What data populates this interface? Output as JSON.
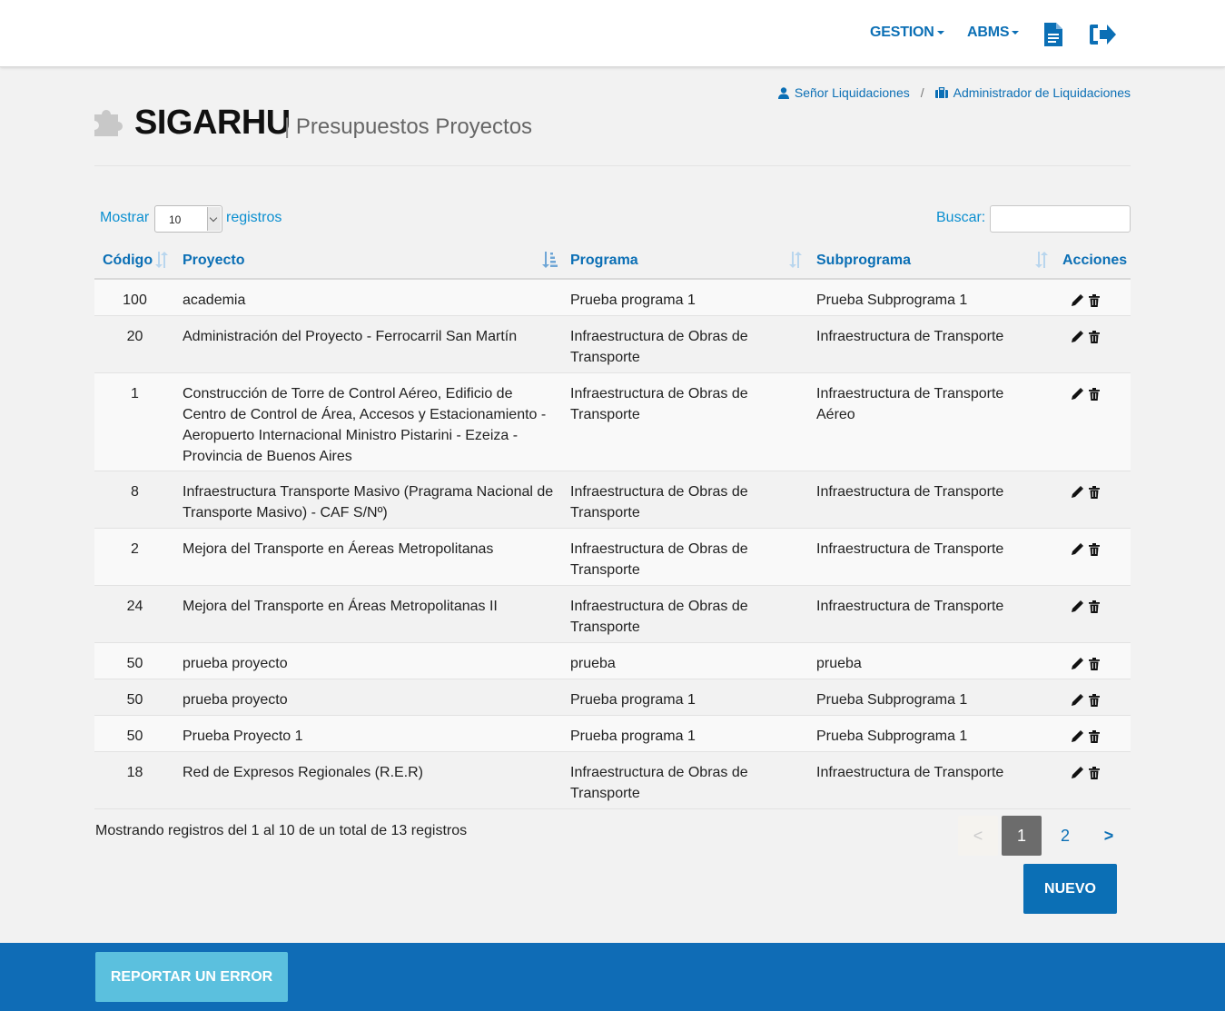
{
  "nav": {
    "gestion": "GESTION",
    "abms": "ABMS"
  },
  "breadcrumb": {
    "user": "Señor Liquidaciones",
    "separator": "/",
    "role": "Administrador de Liquidaciones"
  },
  "header": {
    "title": "SIGARHU",
    "separator": "|",
    "subtitle": "Presupuestos Proyectos"
  },
  "controls": {
    "show_label": "Mostrar",
    "show_value": "10",
    "records_label": "registros",
    "search_label": "Buscar:"
  },
  "table": {
    "columns": [
      "Código",
      "Proyecto",
      "Programa",
      "Subprograma",
      "Acciones"
    ],
    "rows": [
      {
        "codigo": "100",
        "proyecto": "academia",
        "programa": "Prueba programa 1",
        "subprograma": "Prueba Subprograma 1"
      },
      {
        "codigo": "20",
        "proyecto": "Administración del Proyecto - Ferrocarril San Martín",
        "programa": "Infraestructura de Obras de Transporte",
        "subprograma": "Infraestructura de Transporte"
      },
      {
        "codigo": "1",
        "proyecto": "Construcción de Torre de Control Aéreo, Edificio de Centro de Control de Área, Accesos y Estacionamiento - Aeropuerto Internacional Ministro Pistarini - Ezeiza - Provincia de Buenos Aires",
        "programa": "Infraestructura de Obras de Transporte",
        "subprograma": "Infraestructura de Transporte Aéreo"
      },
      {
        "codigo": "8",
        "proyecto": "Infraestructura Transporte Masivo (Pragrama Nacional de Transporte Masivo) - CAF S/Nº)",
        "programa": "Infraestructura de Obras de Transporte",
        "subprograma": "Infraestructura de Transporte"
      },
      {
        "codigo": "2",
        "proyecto": "Mejora del Transporte en Áereas Metropolitanas",
        "programa": "Infraestructura de Obras de Transporte",
        "subprograma": "Infraestructura de Transporte"
      },
      {
        "codigo": "24",
        "proyecto": "Mejora del Transporte en Áreas Metropolitanas II",
        "programa": "Infraestructura de Obras de Transporte",
        "subprograma": "Infraestructura de Transporte"
      },
      {
        "codigo": "50",
        "proyecto": "prueba proyecto",
        "programa": "prueba",
        "subprograma": "prueba"
      },
      {
        "codigo": "50",
        "proyecto": "prueba proyecto",
        "programa": "Prueba programa 1",
        "subprograma": "Prueba Subprograma 1"
      },
      {
        "codigo": "50",
        "proyecto": "Prueba Proyecto 1",
        "programa": "Prueba programa 1",
        "subprograma": "Prueba Subprograma 1"
      },
      {
        "codigo": "18",
        "proyecto": "Red de Expresos Regionales (R.E.R)",
        "programa": "Infraestructura de Obras de Transporte",
        "subprograma": "Infraestructura de Transporte"
      }
    ]
  },
  "footer_info": "Mostrando registros del 1 al 10 de un total de 13 registros",
  "pagination": {
    "prev": "<",
    "current": "1",
    "page2": "2",
    "next": ">"
  },
  "buttons": {
    "nuevo": "NUEVO",
    "report": "REPORTAR UN ERROR"
  },
  "colors": {
    "primary": "#0b6fb5",
    "link": "#0b8fd0",
    "report": "#5bc0de",
    "footer": "#0f6cb6"
  }
}
